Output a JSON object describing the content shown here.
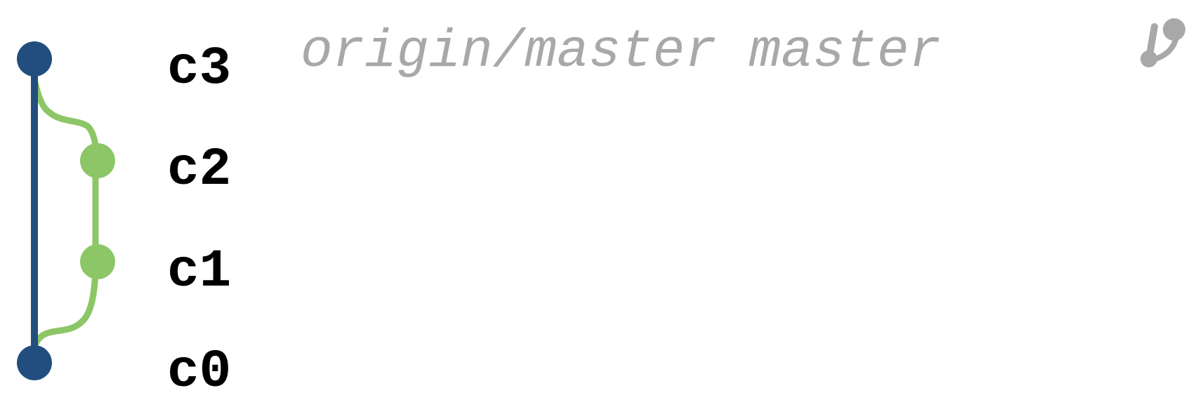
{
  "colors": {
    "mainline": "#214e7e",
    "branch": "#8cc666",
    "ref_text": "#a8a8a8",
    "label_text": "#000000",
    "background": "#ffffff"
  },
  "commits": [
    {
      "id": "c3",
      "label": "c3",
      "lane": "main"
    },
    {
      "id": "c2",
      "label": "c2",
      "lane": "branch"
    },
    {
      "id": "c1",
      "label": "c1",
      "lane": "branch"
    },
    {
      "id": "c0",
      "label": "c0",
      "lane": "main"
    }
  ],
  "refs": {
    "text": "origin/master master",
    "icon": "tag-icon"
  },
  "edges": [
    {
      "from": "c3",
      "to": "c0",
      "type": "main"
    },
    {
      "from": "c3",
      "to": "c2",
      "type": "branch"
    },
    {
      "from": "c2",
      "to": "c1",
      "type": "branch"
    },
    {
      "from": "c1",
      "to": "c0",
      "type": "branch"
    }
  ]
}
